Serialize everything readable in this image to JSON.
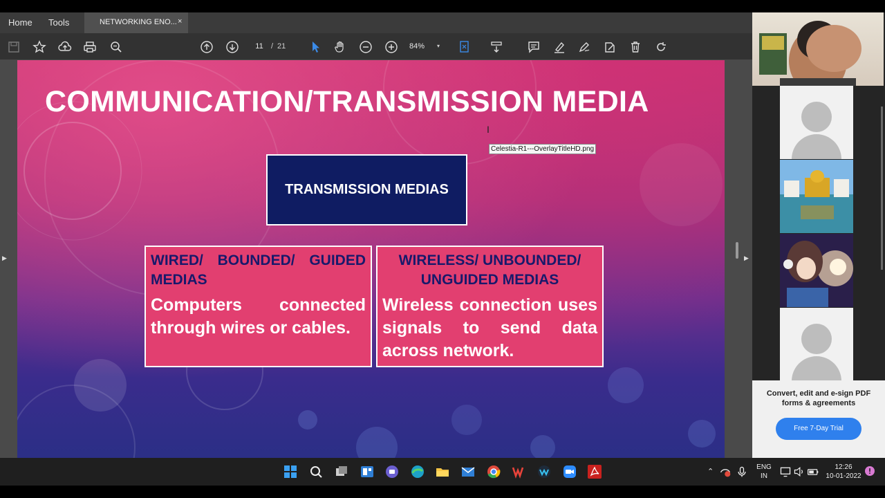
{
  "menu": {
    "home": "Home",
    "tools": "Tools",
    "tab_title": "NETWORKING ENO...",
    "close_glyph": "×"
  },
  "toolbar": {
    "current_page": "11",
    "separator": "/",
    "total_pages": "21",
    "zoom": "84%",
    "dropdown_glyph": "▾"
  },
  "slide": {
    "title": "COMMUNICATION/TRANSMISSION MEDIA",
    "top_box": "TRANSMISSION MEDIAS",
    "left_card": {
      "heading": "WIRED/ BOUNDED/ GUIDED MEDIAS",
      "body": "Computers connected through wires or cables."
    },
    "right_card": {
      "heading": "WIRELESS/ UNBOUNDED/ UNGUIDED MEDIAS",
      "body": "Wireless connection uses signals to send data across network."
    },
    "tooltip": "Celestia-R1---OverlayTitleHD.png"
  },
  "promo": {
    "text": "Convert, edit and e-sign PDF forms & agreements",
    "button": "Free 7-Day Trial"
  },
  "taskbar": {
    "lang_line1": "ENG",
    "lang_line2": "IN",
    "time": "12:26",
    "date": "10-01-2022"
  },
  "colors": {
    "slide_top": "#c8336f",
    "slide_bottom": "#2b2f86",
    "top_box": "#0f1c62",
    "card": "#e23f70",
    "card_heading": "#18196b",
    "trial_button": "#2f80ed"
  }
}
